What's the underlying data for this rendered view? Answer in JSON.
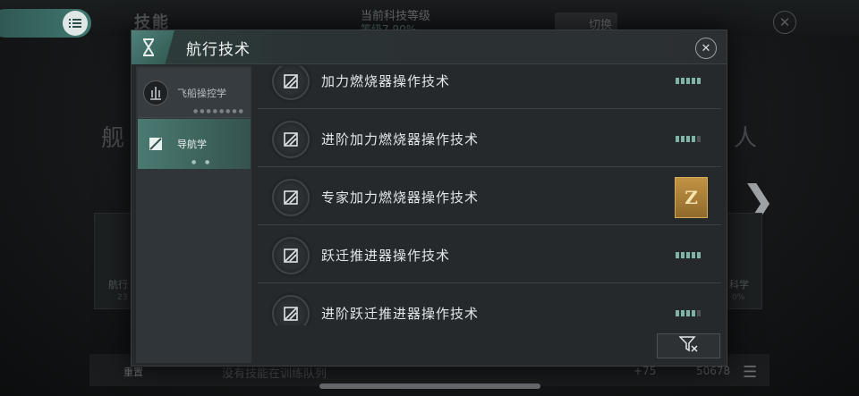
{
  "background": {
    "title": "技能",
    "tech_level_label": "当前科技等级",
    "tech_level_value": "等级7 90%",
    "switch_label": "切换",
    "left_partial": "舰",
    "right_partial": "人",
    "card_left_label": "航行",
    "card_left_sub": "23",
    "card_right_label": "科学",
    "card_right_sub": "0%",
    "reset_label": "重置",
    "queue_text": "没有技能在训练队列",
    "plus_value": "+75",
    "points_value": "50678"
  },
  "modal": {
    "title": "航行技术",
    "sidebar": [
      {
        "label": "飞船操控学",
        "selected": false
      },
      {
        "label": "导航学",
        "selected": true
      }
    ],
    "skills": [
      {
        "name": "加力燃烧器操作技术",
        "level": 5,
        "max": 5,
        "badge": ""
      },
      {
        "name": "进阶加力燃烧器操作技术",
        "level": 4,
        "max": 5,
        "badge": ""
      },
      {
        "name": "专家加力燃烧器操作技术",
        "level": 0,
        "max": 5,
        "badge": "Z"
      },
      {
        "name": "跃迁推进器操作技术",
        "level": 5,
        "max": 5,
        "badge": ""
      },
      {
        "name": "进阶跃迁推进器操作技术",
        "level": 4,
        "max": 5,
        "badge": ""
      }
    ]
  },
  "colors": {
    "accent": "#4f8178",
    "level_on": "#7fb3a8",
    "level_off": "#4b5256",
    "badge_gold": "#c29344"
  },
  "icons": {
    "menu": "list-icon",
    "modal_header": "skill-emblem-icon",
    "close": "close-icon",
    "skill": "navigation-leaf-icon",
    "filter": "filter-icon"
  }
}
